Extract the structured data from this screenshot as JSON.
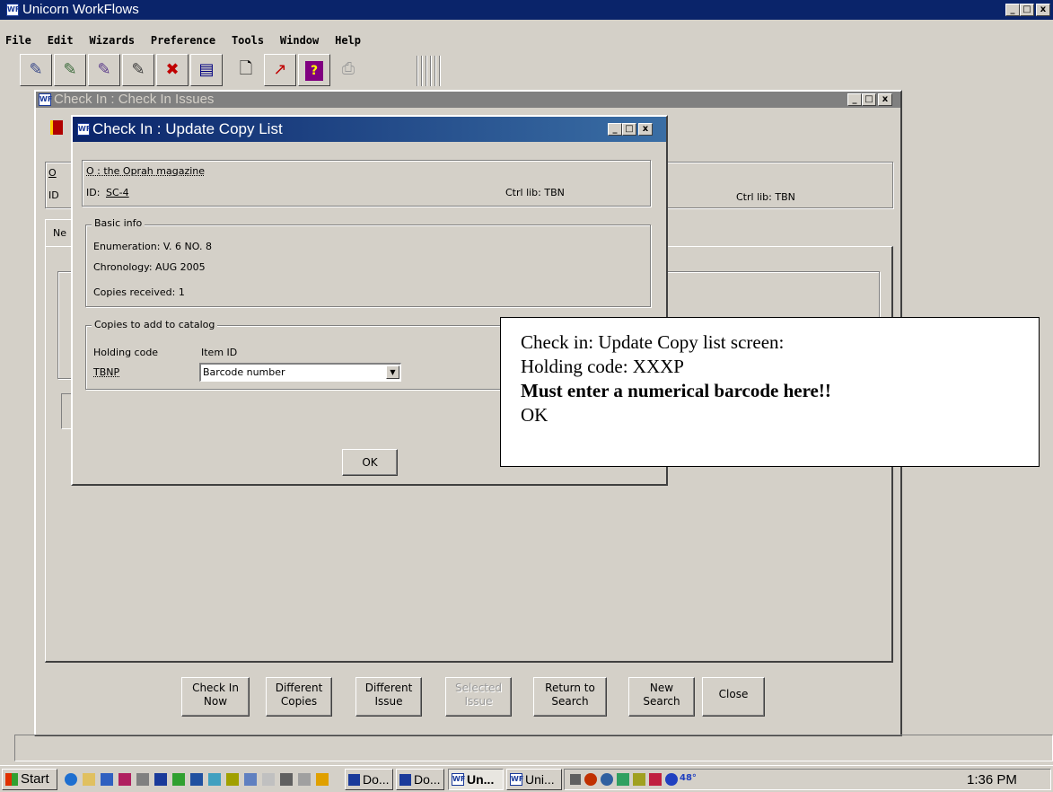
{
  "app": {
    "title": "Unicorn WorkFlows",
    "logo": "WF",
    "menu": [
      "File",
      "Edit",
      "Wizards",
      "Preference",
      "Tools",
      "Window",
      "Help"
    ]
  },
  "toolbar_icons": [
    "checkin-icon",
    "checkin-add-icon",
    "checkin-edit-icon",
    "checkin-modify-icon",
    "checkin-remove-icon",
    "display-icon",
    "cover-icon",
    "chart-icon",
    "help-icon",
    "print-icon"
  ],
  "checkin_issues": {
    "title": "Check In : Check In Issues",
    "left_letter_1": "O",
    "left_letter_2": "ID",
    "ctrl_lib": "Ctrl lib: TBN",
    "tab_partial": "Ne",
    "buttons": {
      "check_in_now": [
        "Check In",
        "Now"
      ],
      "different_copies": [
        "Different",
        "Copies"
      ],
      "different_issue": [
        "Different",
        "Issue"
      ],
      "selected_issue": [
        "Selected",
        "Issue"
      ],
      "return_to_search": [
        "Return to",
        "Search"
      ],
      "new_search": [
        "New",
        "Search"
      ],
      "close": "Close"
    }
  },
  "update_copy_list": {
    "title": "Check In : Update Copy List",
    "serial_title": "O : the Oprah magazine",
    "id_label": "ID:",
    "id_value": "SC-4",
    "ctrl_lib": "Ctrl lib: TBN",
    "basic_info": {
      "legend": "Basic info",
      "enumeration": "Enumeration: V. 6 NO. 8",
      "chronology": "Chronology:  AUG 2005",
      "copies_received": "Copies received: 1"
    },
    "copies_to_add": {
      "legend": "Copies to add to catalog",
      "col_holding": "Holding code",
      "col_item": "Item ID",
      "holding_value": "TBNP",
      "item_value": "Barcode number"
    },
    "ok_label": "OK"
  },
  "callout": {
    "line1": "Check in: Update Copy list screen:",
    "line2": "Holding code: XXXP",
    "line3": "Must enter a numerical barcode here!!",
    "line4": "OK"
  },
  "taskbar": {
    "start": "Start",
    "tasks": [
      "Do...",
      "Do...",
      "Un...",
      "Uni..."
    ],
    "clock": "1:36 PM",
    "temp": "48°"
  }
}
